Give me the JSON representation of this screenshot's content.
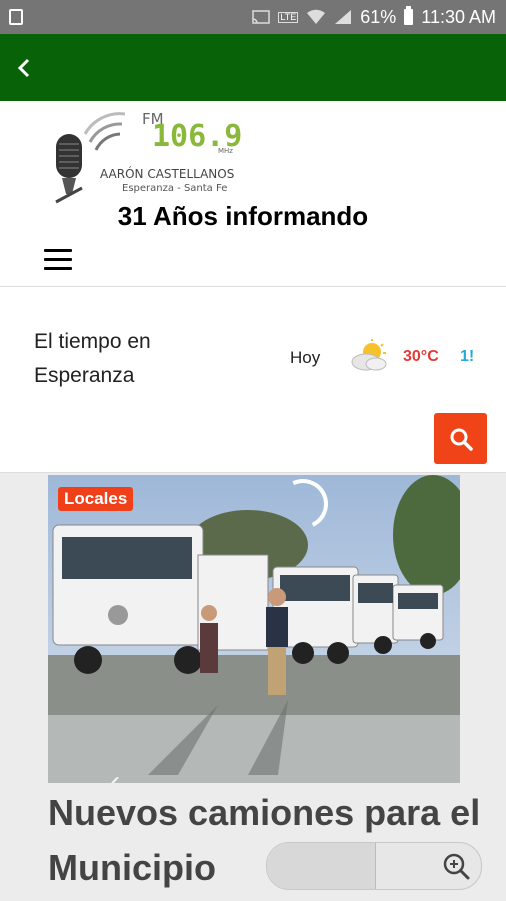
{
  "status_bar": {
    "network": "LTE",
    "battery": "61%",
    "time": "11:30 AM"
  },
  "header": {
    "back_icon": "chevron-left-icon",
    "accent_color": "#086308"
  },
  "logo": {
    "station": "FM",
    "frequency": "106.9",
    "unit": "MHz",
    "name": "AARÓN CASTELLANOS",
    "location": "Esperanza - Santa Fe"
  },
  "tagline": "31 Años informando",
  "weather": {
    "title": "El tiempo en Esperanza",
    "today_label": "Hoy",
    "today_icon": "partly-cloudy-icon",
    "temp_max": "30°C",
    "temp_min_partial": "1!",
    "max_color": "#e53935",
    "min_color": "#29a8e0"
  },
  "search": {
    "icon": "search-icon",
    "color": "#f04418"
  },
  "featured": {
    "category": "Locales",
    "headline": "Nuevos camiones para el Municipio"
  },
  "zoom": {
    "icon": "zoom-in-icon"
  }
}
